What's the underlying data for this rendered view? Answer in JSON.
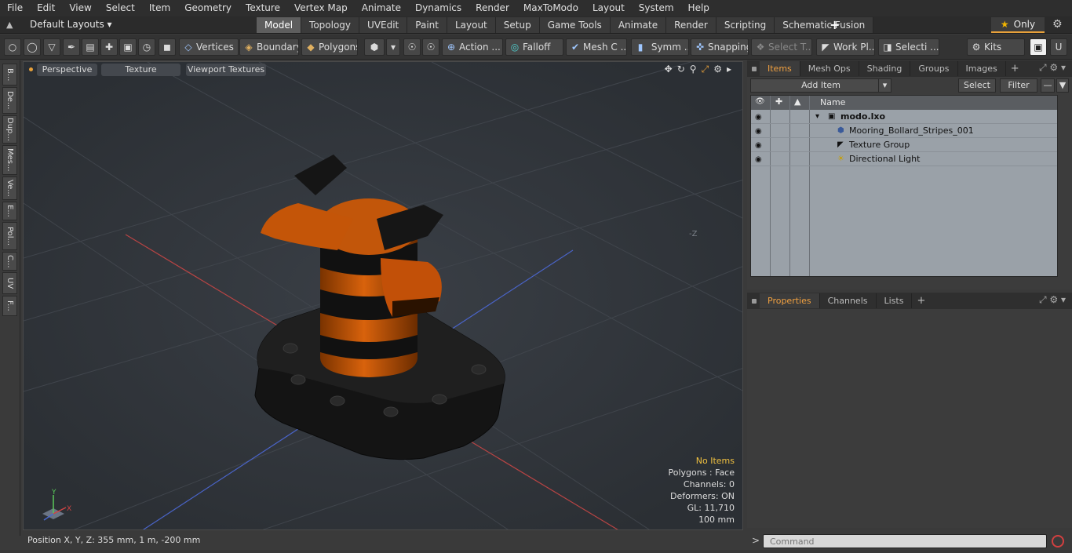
{
  "menu": [
    "File",
    "Edit",
    "View",
    "Select",
    "Item",
    "Geometry",
    "Texture",
    "Vertex Map",
    "Animate",
    "Dynamics",
    "Render",
    "MaxToModo",
    "Layout",
    "System",
    "Help"
  ],
  "layout_bar": {
    "layouts_label": "Default Layouts",
    "tabs": [
      "Model",
      "Topology",
      "UVEdit",
      "Paint",
      "Layout",
      "Setup",
      "Game Tools",
      "Animate",
      "Render",
      "Scripting",
      "Schematic Fusion"
    ],
    "active_tab": "Model",
    "add_label": "+",
    "only_label": "Only"
  },
  "toolbar": {
    "vertices": "Vertices",
    "boundary": "Boundary",
    "polygons": "Polygons",
    "action": "Action",
    "falloff": "Falloff",
    "mesh_c": "Mesh C ...",
    "symm": "Symm ...",
    "snapping": "Snapping",
    "select_t": "Select T...",
    "work_pl": "Work Pl...",
    "selecti": "Selecti ...",
    "kits": "Kits",
    "ellipsis": "..."
  },
  "left_strip": [
    "B...",
    "De...",
    "Dup...",
    "Mes...",
    "Ve...",
    "E...",
    "Pol...",
    "C...",
    "UV",
    "F..."
  ],
  "viewport": {
    "view_mode": "Perspective",
    "shading": "Texture",
    "viewport_textures": "Viewport Textures",
    "axis_label_neg_z": "-Z",
    "info": {
      "selection": "No Items",
      "polygons": "Polygons : Face",
      "channels": "Channels: 0",
      "deformers": "Deformers: ON",
      "gl": "GL: 11,710",
      "grid": "100 mm"
    },
    "axes": {
      "y": "Y",
      "x": "X"
    }
  },
  "status": {
    "position": "Position X, Y, Z:  355 mm, 1 m, -200 mm"
  },
  "items_panel": {
    "tabs": [
      "Items",
      "Mesh Ops",
      "Shading",
      "Groups",
      "Images"
    ],
    "active_tab": "Items",
    "add_item": "Add Item",
    "select": "Select",
    "filter": "Filter",
    "column_name": "Name",
    "rows": [
      {
        "label": "modo.lxo",
        "icon": "scene-icon",
        "level": 0
      },
      {
        "label": "Mooring_Bollard_Stripes_001",
        "icon": "mesh-icon",
        "level": 1
      },
      {
        "label": "Texture Group",
        "icon": "texture-group-icon",
        "level": 1
      },
      {
        "label": "Directional Light",
        "icon": "light-icon",
        "level": 1
      }
    ]
  },
  "properties_panel": {
    "tabs": [
      "Properties",
      "Channels",
      "Lists"
    ],
    "active_tab": "Properties"
  },
  "command": {
    "prompt": ">",
    "placeholder": "Command"
  },
  "colors": {
    "accent_orange": "#f0a040",
    "viewport_bg": "#2e3238",
    "info_highlight": "#f0c040"
  }
}
